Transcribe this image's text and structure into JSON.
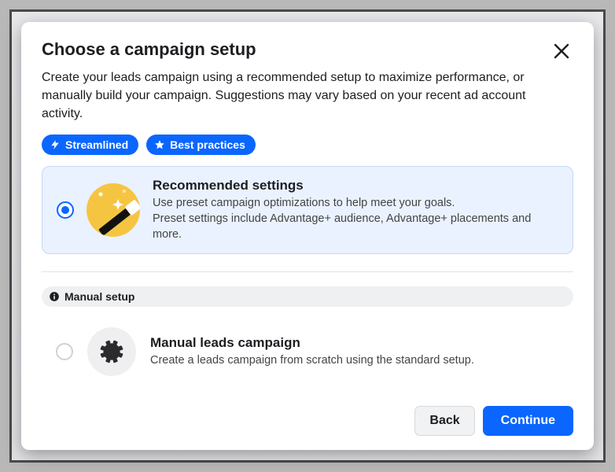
{
  "modal": {
    "title": "Choose a campaign setup",
    "description": "Create your leads campaign using a recommended setup to maximize performance, or manually build your campaign. Suggestions may vary based on your recent ad account activity.",
    "close_icon": "close"
  },
  "badges": {
    "streamlined": {
      "label": "Streamlined",
      "icon": "lightning"
    },
    "best_practices": {
      "label": "Best practices",
      "icon": "star"
    }
  },
  "options": {
    "recommended": {
      "title": "Recommended settings",
      "line1": "Use preset campaign optimizations to help meet your goals.",
      "line2": "Preset settings include Advantage+ audience, Advantage+ placements and more.",
      "selected": true,
      "illustration": "magic-wand"
    },
    "manual": {
      "tag_label": "Manual setup",
      "tag_icon": "info",
      "title": "Manual leads campaign",
      "line1": "Create a leads campaign from scratch using the standard setup.",
      "selected": false,
      "illustration": "gear"
    }
  },
  "footer": {
    "back": "Back",
    "continue": "Continue"
  }
}
